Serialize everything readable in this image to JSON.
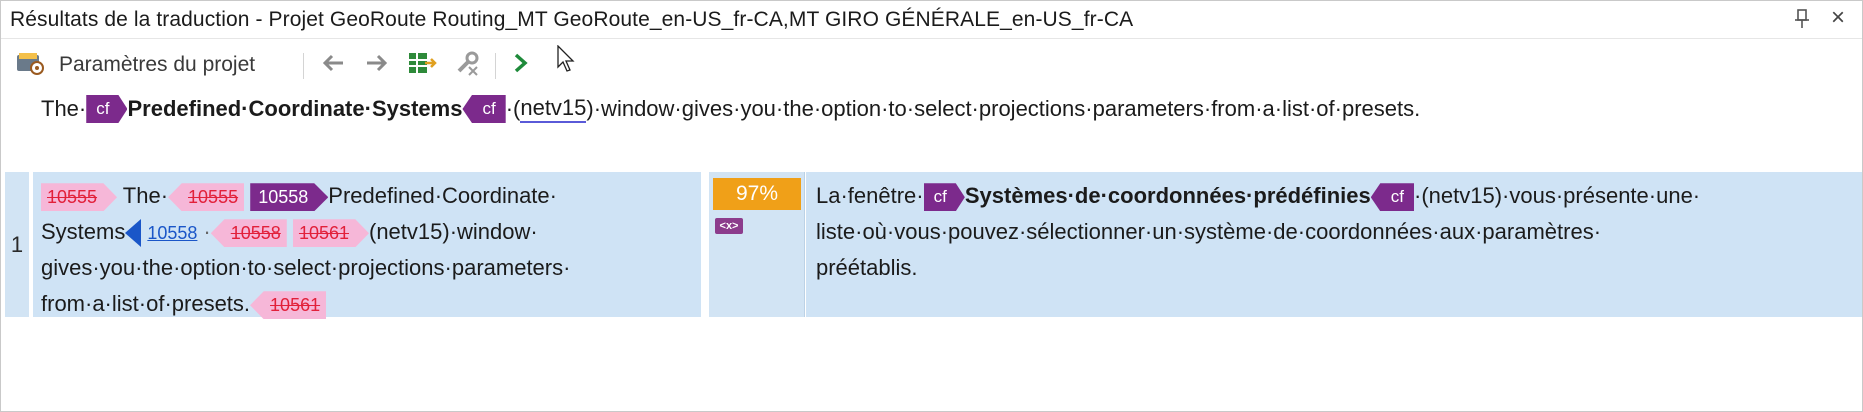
{
  "window": {
    "title": "Résultats de la traduction - Projet GeoRoute Routing_MT GeoRoute_en-US_fr-CA,MT GIRO GÉNÉRALE_en-US_fr-CA",
    "close_glyph": "×"
  },
  "toolbar": {
    "project_settings_label": "Paramètres du projet"
  },
  "source_preview": {
    "part1": "The·",
    "tag_open": "cf",
    "bold_text": "Predefined·Coordinate·Systems",
    "tag_close": "cf",
    "part2": "·(",
    "netv": "netv15",
    "part3": ")·window·gives·you·the·option·to·select·projections·parameters·from·a·list·of·presets."
  },
  "row": {
    "number": "1",
    "source": {
      "tag_a": "10555",
      "text_the": "The·",
      "tag_b": "10555",
      "tag_c": "10558",
      "text_1": "Predefined·Coordinate·",
      "text_2": "Systems",
      "tag_d": "10558",
      "text_dot": "·",
      "tag_e": "10558",
      "tag_f": "10561",
      "text_3": "(netv15)·window·",
      "text_4": "gives·you·the·option·to·select·projections·parameters·",
      "text_5": "from·a·list·of·presets.",
      "tag_g": "10561"
    },
    "match_percent": "97%",
    "mt_badge": "<x>",
    "target": {
      "text_1": "La·fenêtre·",
      "tag_open": "cf",
      "bold": "Systèmes·de·coordonnées·prédéfinies",
      "tag_close": "cf",
      "text_2": "·(netv15)·vous·présente·une·",
      "text_3": "liste·où·vous·pouvez·sélectionner·un·système·de·coordonnées·aux·paramètres·",
      "text_4": "préétablis."
    }
  }
}
